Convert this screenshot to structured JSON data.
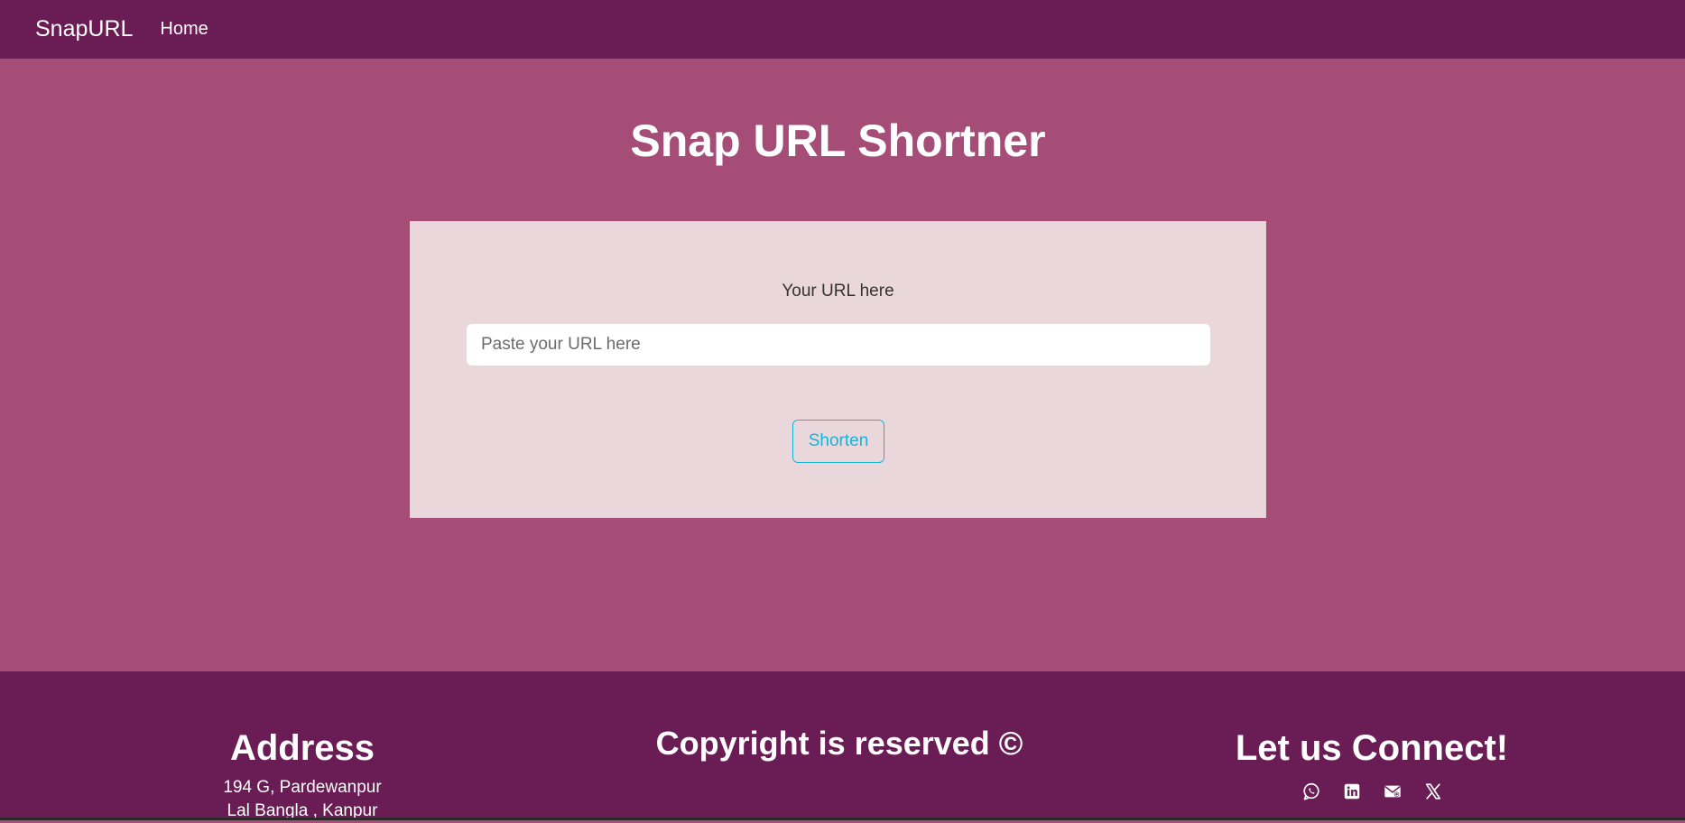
{
  "nav": {
    "brand": "SnapURL",
    "home": "Home"
  },
  "main": {
    "title": "Snap URL Shortner",
    "form": {
      "label": "Your URL here",
      "placeholder": "Paste your URL here",
      "value": "",
      "button": "Shorten"
    }
  },
  "footer": {
    "address": {
      "heading": "Address",
      "lines": [
        "194 G, Pardewanpur",
        "Lal Bangla , Kanpur"
      ]
    },
    "copyright": {
      "heading": "Copyright is reserved ©"
    },
    "connect": {
      "heading": "Let us Connect!",
      "icons": [
        "whatsapp-icon",
        "linkedin-icon",
        "mail-icon",
        "x-icon"
      ]
    }
  },
  "colors": {
    "navbar": "#6a1c54",
    "background": "#a64d77",
    "card": "#ead7db",
    "button_accent": "#17b4d8",
    "text_light": "#ffffff"
  }
}
